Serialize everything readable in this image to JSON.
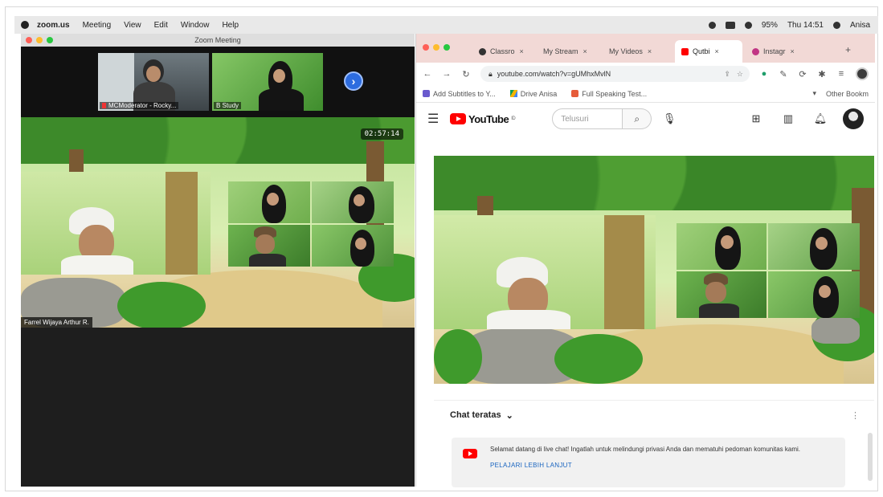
{
  "menubar": {
    "app": "zoom.us",
    "items": [
      "Meeting",
      "View",
      "Edit",
      "Window",
      "Help"
    ],
    "battery": "95%",
    "datetime": "Thu 14:51",
    "user": "Anisa"
  },
  "zoom": {
    "window_title": "Zoom Meeting",
    "strip": [
      {
        "name": "MCModerator - Rocky..."
      },
      {
        "name": "B Study"
      }
    ],
    "timer": "02:57:14",
    "speaker_name": "Farrel Wijaya Arthur R."
  },
  "browser": {
    "tabs": [
      "Classro",
      "My Stream",
      "My Videos",
      "Qutbi",
      "Instagr"
    ],
    "url": "youtube.com/watch?v=gUMhxMvlN",
    "bookmarks": [
      "Add Subtitles to Y...",
      "Drive Anisa",
      "Full Speaking Test..."
    ],
    "other_bookmarks": "Other Bookm"
  },
  "youtube": {
    "logo_text": "YouTube",
    "logo_region": "ID",
    "search_placeholder": "Telusuri"
  },
  "chat": {
    "header": "Chat teratas",
    "notice": "Selamat datang di live chat! Ingatlah untuk melindungi privasi Anda dan mematuhi pedoman komunitas kami.",
    "link": "PELAJARI LEBIH LANJUT"
  },
  "colors": {
    "zoom_bg": "#1e1e1e",
    "tabbar": "#f2d9d6",
    "yt_red": "#ff0000",
    "zoom_next": "#2d6cdf"
  }
}
